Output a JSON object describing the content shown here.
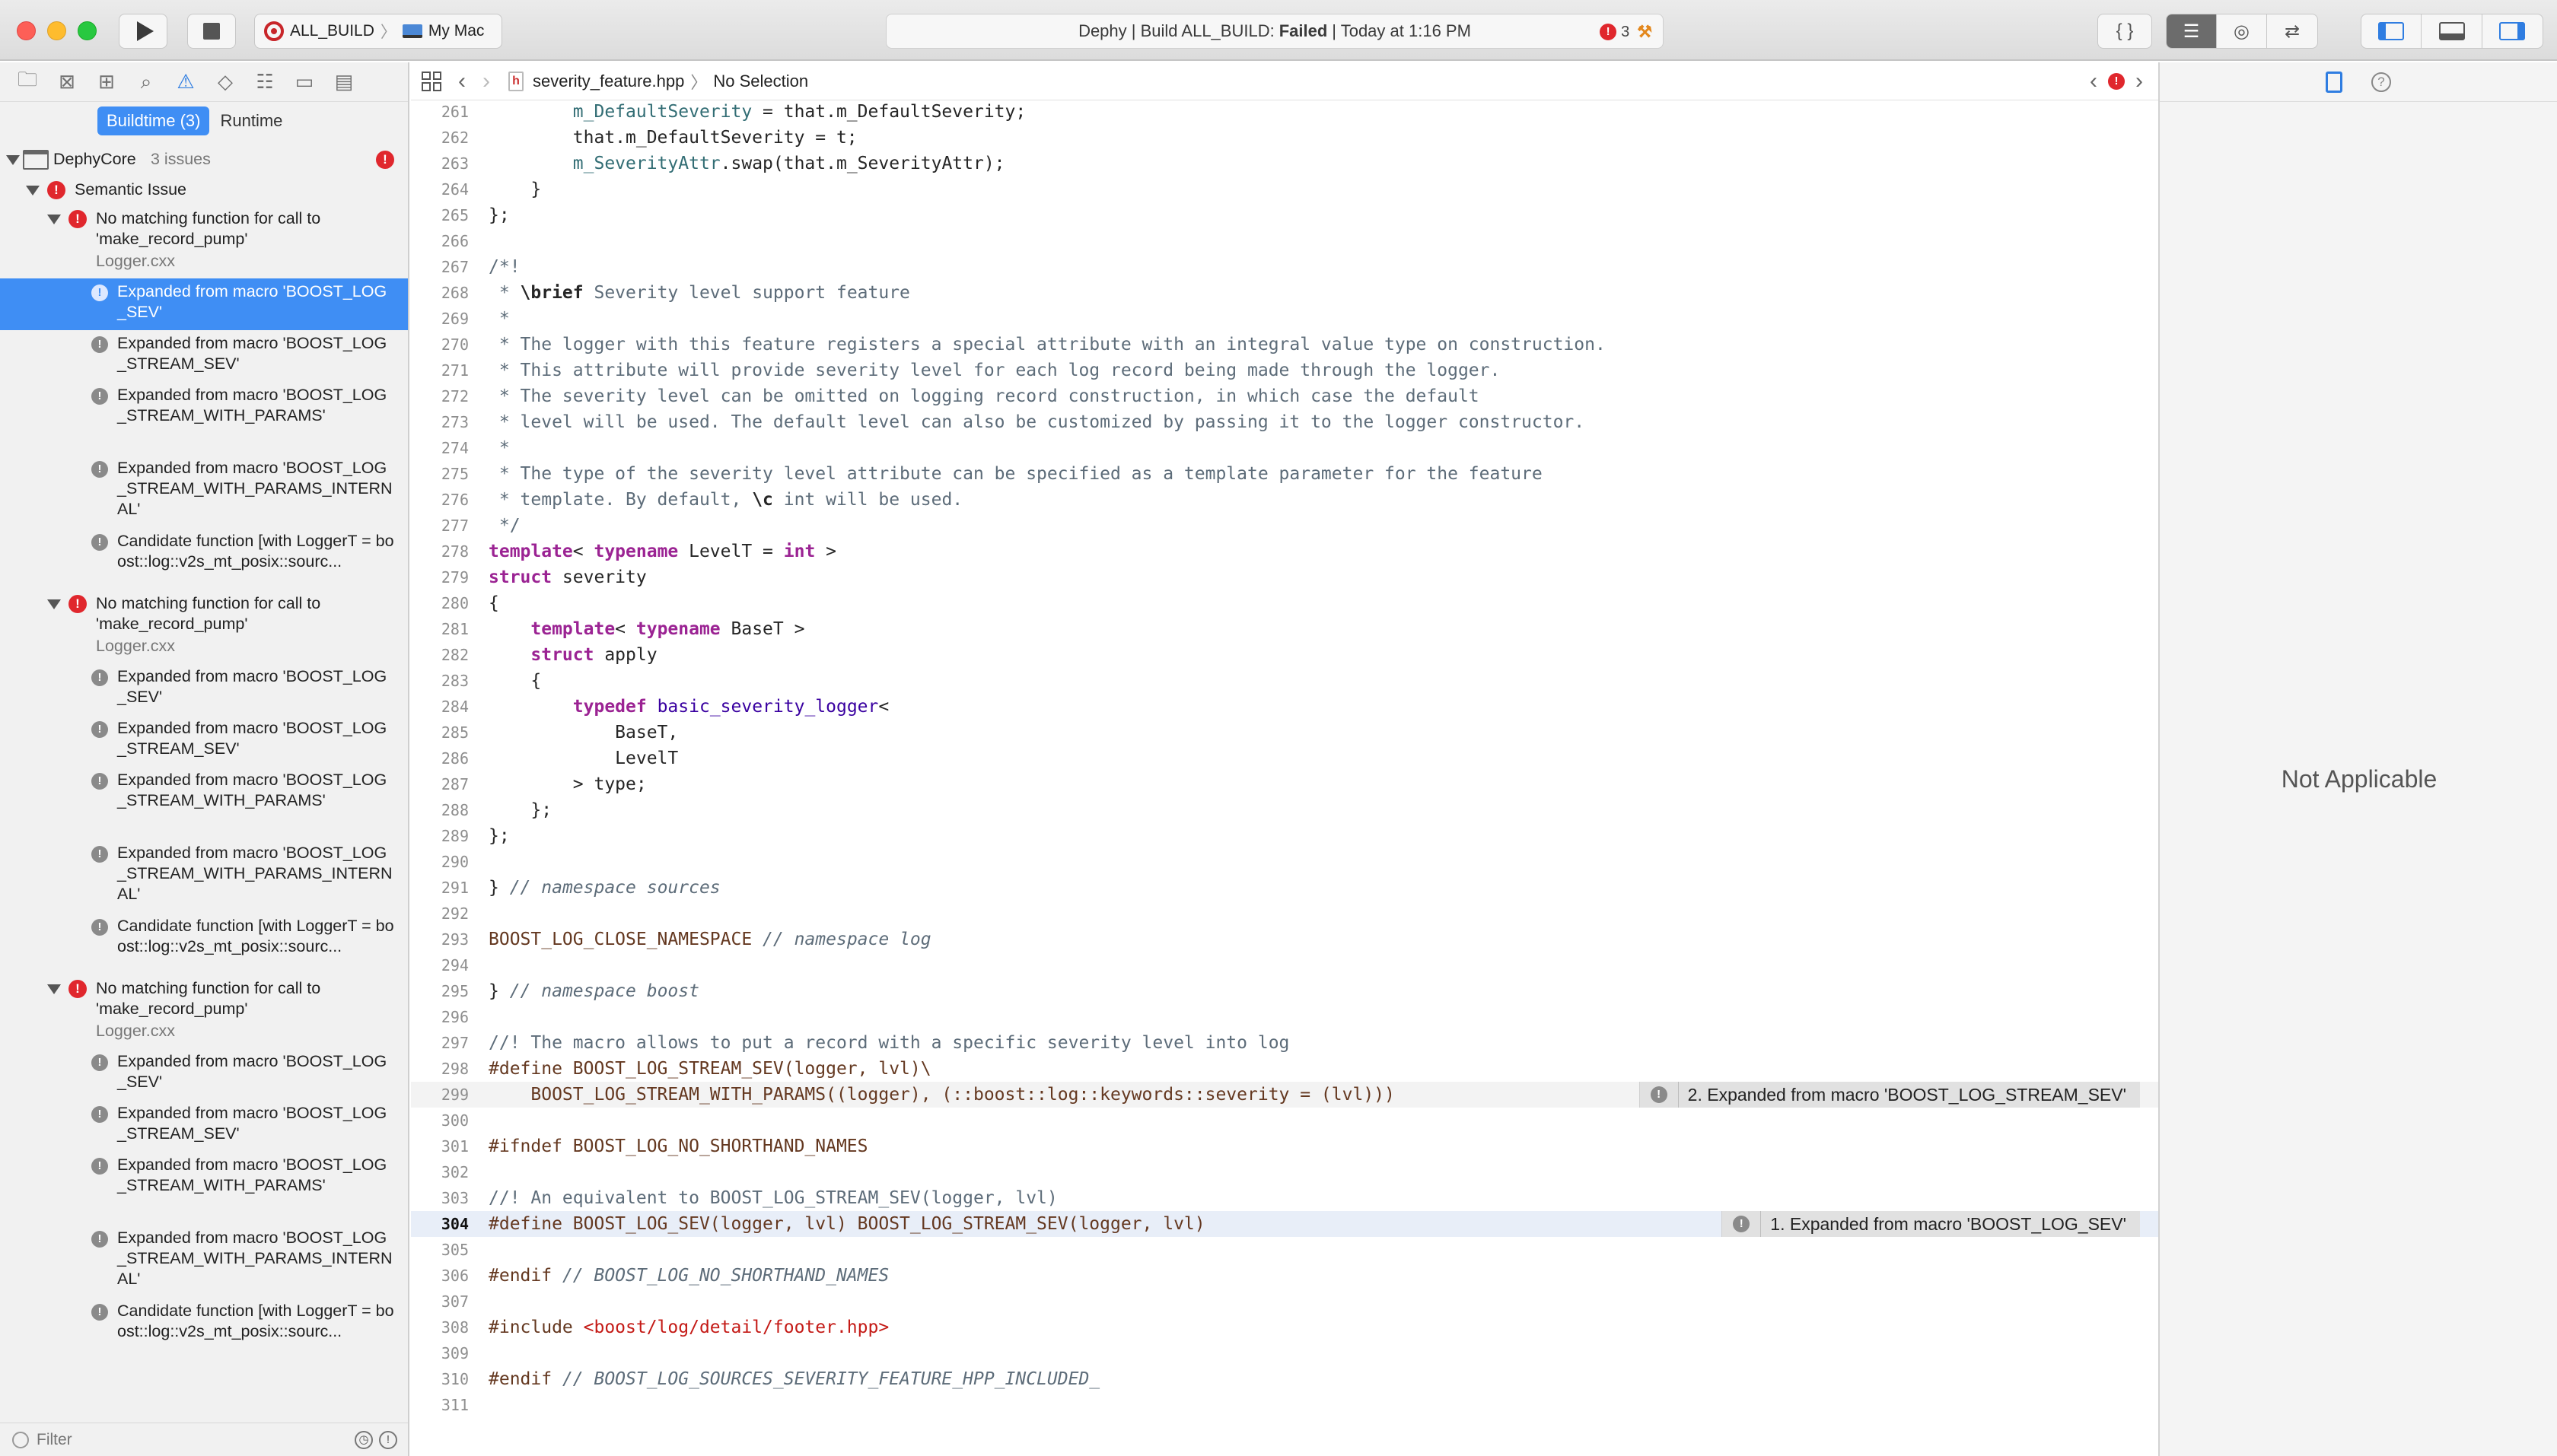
{
  "toolbar": {
    "scheme": "ALL_BUILD",
    "destination": "My Mac",
    "activity": {
      "prefix": "Dephy | Build ALL_BUILD:",
      "status": "Failed",
      "time": "| Today at 1:16 PM",
      "error_count": "3"
    },
    "library_label": "{ }"
  },
  "navigator": {
    "scope_buildtime": "Buildtime (3)",
    "scope_runtime": "Runtime",
    "project": "DephyCore",
    "project_count": "3 issues",
    "category": "Semantic Issue",
    "groups": [
      {
        "title": "No matching function for call to 'make_record_pump'",
        "file": "Logger.cxx",
        "notes": [
          "Expanded from macro 'BOOST_LOG_SEV'",
          "Expanded from macro 'BOOST_LOG_STREAM_SEV'",
          "Expanded from macro 'BOOST_LOG_STREAM_WITH_PARAMS'",
          "Expanded from macro 'BOOST_LOG_STREAM_WITH_PARAMS_INTERNAL'",
          "Candidate function [with LoggerT = boost::log::v2s_mt_posix::sourc..."
        ]
      },
      {
        "title": "No matching function for call to 'make_record_pump'",
        "file": "Logger.cxx",
        "notes": [
          "Expanded from macro 'BOOST_LOG_SEV'",
          "Expanded from macro 'BOOST_LOG_STREAM_SEV'",
          "Expanded from macro 'BOOST_LOG_STREAM_WITH_PARAMS'",
          "Expanded from macro 'BOOST_LOG_STREAM_WITH_PARAMS_INTERNAL'",
          "Candidate function [with LoggerT = boost::log::v2s_mt_posix::sourc..."
        ]
      },
      {
        "title": "No matching function for call to 'make_record_pump'",
        "file": "Logger.cxx",
        "notes": [
          "Expanded from macro 'BOOST_LOG_SEV'",
          "Expanded from macro 'BOOST_LOG_STREAM_SEV'",
          "Expanded from macro 'BOOST_LOG_STREAM_WITH_PARAMS'",
          "Expanded from macro 'BOOST_LOG_STREAM_WITH_PARAMS_INTERNAL'",
          "Candidate function [with LoggerT = boost::log::v2s_mt_posix::sourc..."
        ]
      }
    ],
    "selected": "group0-note0",
    "filter_placeholder": "Filter"
  },
  "editor": {
    "jump_file": "severity_feature.hpp",
    "jump_selection": "No Selection",
    "current_line": 304,
    "lines": [
      {
        "n": 261,
        "code": [
          [
            "        ",
            ""
          ],
          [
            "m_DefaultSeverity",
            "m"
          ],
          [
            " = that.m_DefaultSeverity;",
            ""
          ]
        ]
      },
      {
        "n": 262,
        "code": [
          [
            "        that.m_DefaultSeverity = t;",
            ""
          ]
        ]
      },
      {
        "n": 263,
        "code": [
          [
            "        ",
            ""
          ],
          [
            "m_SeverityAttr",
            "m"
          ],
          [
            ".swap(that.m_SeverityAttr);",
            ""
          ]
        ]
      },
      {
        "n": 264,
        "code": [
          [
            "    }",
            ""
          ]
        ]
      },
      {
        "n": 265,
        "code": [
          [
            "};",
            ""
          ]
        ]
      },
      {
        "n": 266,
        "code": []
      },
      {
        "n": 267,
        "code": [
          [
            "/*!",
            "c"
          ]
        ]
      },
      {
        "n": 268,
        "code": [
          [
            " * ",
            "c"
          ],
          [
            "\\brief",
            "cb"
          ],
          [
            " Severity level support feature",
            "c"
          ]
        ]
      },
      {
        "n": 269,
        "code": [
          [
            " *",
            "c"
          ]
        ]
      },
      {
        "n": 270,
        "code": [
          [
            " * The logger with this feature registers a special attribute with an integral value type on construction.",
            "c"
          ]
        ]
      },
      {
        "n": 271,
        "code": [
          [
            " * This attribute will provide severity level for each log record being made through the logger.",
            "c"
          ]
        ]
      },
      {
        "n": 272,
        "code": [
          [
            " * The severity level can be omitted on logging record construction, in which case the default",
            "c"
          ]
        ]
      },
      {
        "n": 273,
        "code": [
          [
            " * level will be used. The default level can also be customized by passing it to the logger constructor.",
            "c"
          ]
        ]
      },
      {
        "n": 274,
        "code": [
          [
            " *",
            "c"
          ]
        ]
      },
      {
        "n": 275,
        "code": [
          [
            " * The type of the severity level attribute can be specified as a template parameter for the feature",
            "c"
          ]
        ]
      },
      {
        "n": 276,
        "code": [
          [
            " * template. By default, ",
            "c"
          ],
          [
            "\\c",
            "cb"
          ],
          [
            " int will be used.",
            "c"
          ]
        ]
      },
      {
        "n": 277,
        "code": [
          [
            " */",
            "c"
          ]
        ]
      },
      {
        "n": 278,
        "code": [
          [
            "template",
            "k"
          ],
          [
            "< ",
            ""
          ],
          [
            "typename",
            "k"
          ],
          [
            " LevelT = ",
            ""
          ],
          [
            "int",
            "k"
          ],
          [
            " >",
            ""
          ]
        ]
      },
      {
        "n": 279,
        "code": [
          [
            "struct",
            "k"
          ],
          [
            " severity",
            ""
          ]
        ]
      },
      {
        "n": 280,
        "code": [
          [
            "{",
            ""
          ]
        ]
      },
      {
        "n": 281,
        "code": [
          [
            "    ",
            ""
          ],
          [
            "template",
            "k"
          ],
          [
            "< ",
            ""
          ],
          [
            "typename",
            "k"
          ],
          [
            " BaseT >",
            ""
          ]
        ]
      },
      {
        "n": 282,
        "code": [
          [
            "    ",
            ""
          ],
          [
            "struct",
            "k"
          ],
          [
            " apply",
            ""
          ]
        ]
      },
      {
        "n": 283,
        "code": [
          [
            "    {",
            ""
          ]
        ]
      },
      {
        "n": 284,
        "code": [
          [
            "        ",
            ""
          ],
          [
            "typedef",
            "k"
          ],
          [
            " ",
            ""
          ],
          [
            "basic_severity_logger",
            "t"
          ],
          [
            "<",
            ""
          ]
        ]
      },
      {
        "n": 285,
        "code": [
          [
            "            BaseT,",
            ""
          ]
        ]
      },
      {
        "n": 286,
        "code": [
          [
            "            LevelT",
            ""
          ]
        ]
      },
      {
        "n": 287,
        "code": [
          [
            "        > type;",
            ""
          ]
        ]
      },
      {
        "n": 288,
        "code": [
          [
            "    };",
            ""
          ]
        ]
      },
      {
        "n": 289,
        "code": [
          [
            "};",
            ""
          ]
        ]
      },
      {
        "n": 290,
        "code": []
      },
      {
        "n": 291,
        "code": [
          [
            "} ",
            ""
          ],
          [
            "// namespace sources",
            "ci"
          ]
        ]
      },
      {
        "n": 292,
        "code": []
      },
      {
        "n": 293,
        "code": [
          [
            "BOOST_LOG_CLOSE_NAMESPACE",
            "p"
          ],
          [
            " ",
            ""
          ],
          [
            "// namespace log",
            "ci"
          ]
        ]
      },
      {
        "n": 294,
        "code": []
      },
      {
        "n": 295,
        "code": [
          [
            "} ",
            ""
          ],
          [
            "// namespace boost",
            "ci"
          ]
        ]
      },
      {
        "n": 296,
        "code": []
      },
      {
        "n": 297,
        "code": [
          [
            "//! The macro allows to put a record with a specific severity level into log",
            "c"
          ]
        ]
      },
      {
        "n": 298,
        "code": [
          [
            "#define BOOST_LOG_STREAM_SEV(logger, lvl)\\",
            "p"
          ]
        ]
      },
      {
        "n": 299,
        "code": [
          [
            "    BOOST_LOG_STREAM_WITH_PARAMS((logger), (::boost::log::keywords::severity = (lvl)))",
            "p"
          ]
        ],
        "annot": "2. Expanded from macro 'BOOST_LOG_STREAM_SEV'"
      },
      {
        "n": 300,
        "code": []
      },
      {
        "n": 301,
        "code": [
          [
            "#ifndef BOOST_LOG_NO_SHORTHAND_NAMES",
            "p"
          ]
        ]
      },
      {
        "n": 302,
        "code": []
      },
      {
        "n": 303,
        "code": [
          [
            "//! An equivalent to BOOST_LOG_STREAM_SEV(logger, lvl)",
            "c"
          ]
        ]
      },
      {
        "n": 304,
        "code": [
          [
            "#define BOOST_LOG_SEV(logger, lvl) BOOST_LOG_STREAM_SEV(logger, lvl)",
            "p"
          ]
        ],
        "annot": "1. Expanded from macro 'BOOST_LOG_SEV'"
      },
      {
        "n": 305,
        "code": []
      },
      {
        "n": 306,
        "code": [
          [
            "#endif ",
            "p"
          ],
          [
            "// BOOST_LOG_NO_SHORTHAND_NAMES",
            "ci"
          ]
        ]
      },
      {
        "n": 307,
        "code": []
      },
      {
        "n": 308,
        "code": [
          [
            "#include ",
            "p"
          ],
          [
            "<boost/log/detail/footer.hpp>",
            "s"
          ]
        ]
      },
      {
        "n": 309,
        "code": []
      },
      {
        "n": 310,
        "code": [
          [
            "#endif ",
            "p"
          ],
          [
            "// BOOST_LOG_SOURCES_SEVERITY_FEATURE_HPP_INCLUDED_",
            "ci"
          ]
        ]
      },
      {
        "n": 311,
        "code": []
      }
    ]
  },
  "inspector": {
    "message": "Not Applicable"
  }
}
